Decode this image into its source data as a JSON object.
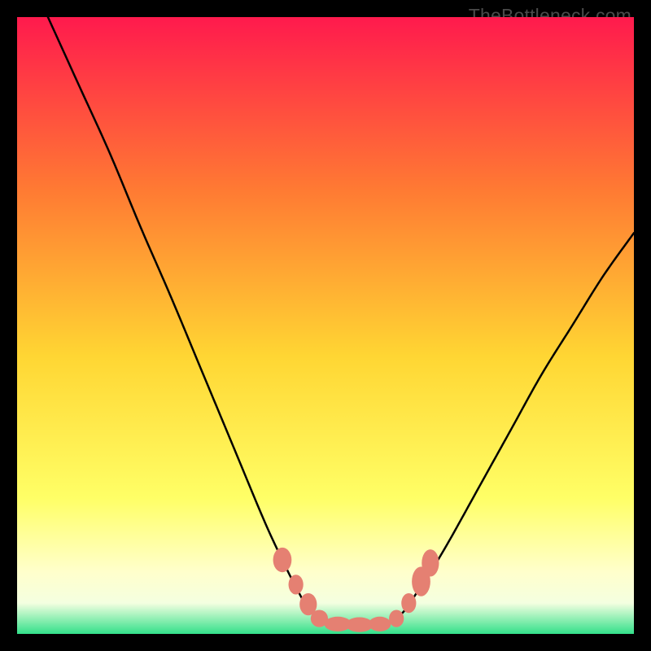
{
  "watermark": "TheBottleneck.com",
  "chart_data": {
    "type": "line",
    "title": "",
    "xlabel": "",
    "ylabel": "",
    "xlim": [
      0,
      100
    ],
    "ylim": [
      0,
      100
    ],
    "grid": false,
    "background_gradient": {
      "top": "#ff1a4d",
      "upper_mid": "#ff7a33",
      "mid": "#ffd633",
      "lower_mid": "#ffff66",
      "pale": "#ffffcc",
      "bottom": "#33e08a"
    },
    "series": [
      {
        "name": "left-arm",
        "stroke": "#000000",
        "x": [
          5,
          10,
          15,
          20,
          25,
          30,
          35,
          40,
          43,
          45,
          47,
          49.5
        ],
        "y": [
          100,
          89,
          78,
          66,
          54.5,
          42.5,
          30.5,
          18.5,
          12,
          8,
          4.5,
          2
        ]
      },
      {
        "name": "right-arm",
        "stroke": "#000000",
        "x": [
          61,
          63,
          65,
          67,
          70,
          75,
          80,
          85,
          90,
          95,
          100
        ],
        "y": [
          2,
          4,
          7,
          10,
          15,
          24,
          33,
          42,
          50,
          58,
          65
        ]
      },
      {
        "name": "bottom-flat",
        "stroke": "#000000",
        "x": [
          49.5,
          52,
          55,
          58,
          61
        ],
        "y": [
          2,
          1.6,
          1.5,
          1.6,
          2
        ]
      }
    ],
    "markers": [
      {
        "name": "marker-left-1",
        "x": 43.0,
        "y": 12.0,
        "rx": 1.5,
        "ry": 2.0,
        "fill": "#e58072"
      },
      {
        "name": "marker-left-2",
        "x": 45.2,
        "y": 8.0,
        "rx": 1.2,
        "ry": 1.6,
        "fill": "#e58072"
      },
      {
        "name": "marker-left-3",
        "x": 47.2,
        "y": 4.8,
        "rx": 1.4,
        "ry": 1.8,
        "fill": "#e58072"
      },
      {
        "name": "marker-left-4",
        "x": 49.0,
        "y": 2.5,
        "rx": 1.4,
        "ry": 1.4,
        "fill": "#e58072"
      },
      {
        "name": "marker-bottom-1",
        "x": 52.0,
        "y": 1.6,
        "rx": 2.2,
        "ry": 1.2,
        "fill": "#e58072"
      },
      {
        "name": "marker-bottom-2",
        "x": 55.5,
        "y": 1.5,
        "rx": 2.2,
        "ry": 1.2,
        "fill": "#e58072"
      },
      {
        "name": "marker-bottom-3",
        "x": 58.8,
        "y": 1.6,
        "rx": 1.8,
        "ry": 1.2,
        "fill": "#e58072"
      },
      {
        "name": "marker-right-1",
        "x": 61.5,
        "y": 2.5,
        "rx": 1.2,
        "ry": 1.4,
        "fill": "#e58072"
      },
      {
        "name": "marker-right-2",
        "x": 63.5,
        "y": 5.0,
        "rx": 1.2,
        "ry": 1.6,
        "fill": "#e58072"
      },
      {
        "name": "marker-right-3",
        "x": 65.5,
        "y": 8.5,
        "rx": 1.5,
        "ry": 2.4,
        "fill": "#e58072"
      },
      {
        "name": "marker-right-4",
        "x": 67.0,
        "y": 11.5,
        "rx": 1.4,
        "ry": 2.2,
        "fill": "#e58072"
      }
    ]
  }
}
